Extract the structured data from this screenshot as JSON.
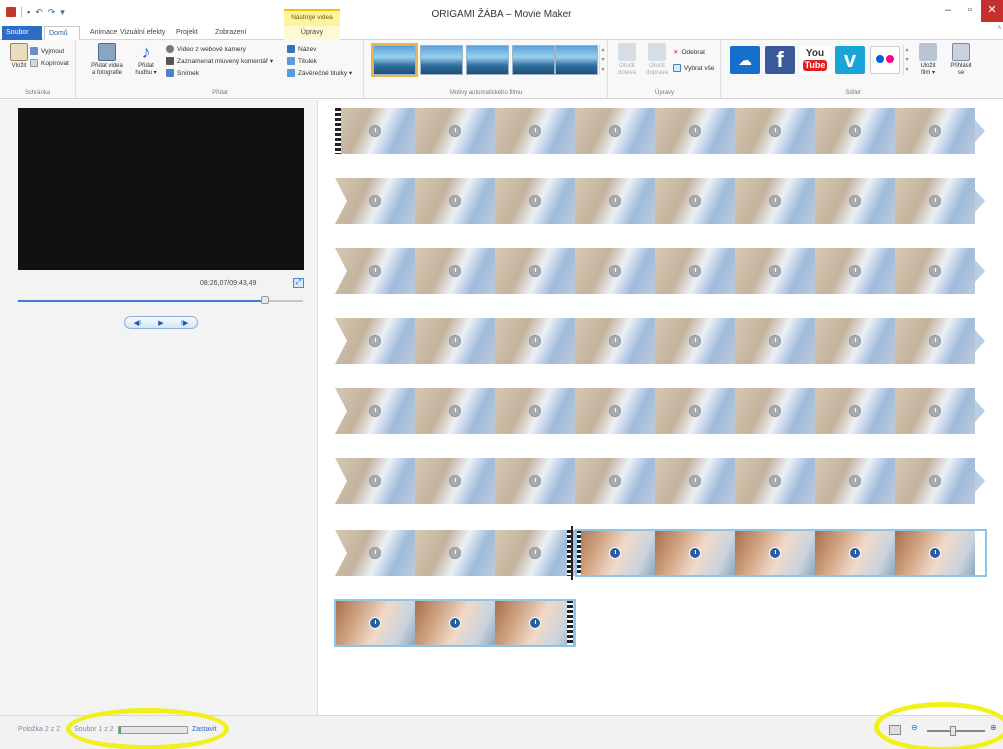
{
  "window": {
    "title": "ORIGAMI ŽÁBA – Movie Maker",
    "contextual_tab_group": "Nástroje videa",
    "minimize_glyph": "–",
    "maximize_glyph": "▫",
    "close_glyph": "✕",
    "help_glyph": "^"
  },
  "tabs": [
    "Soubor",
    "Domů",
    "Animace",
    "Vizuální efekty",
    "Projekt",
    "Zobrazení",
    "Úpravy"
  ],
  "ribbon": {
    "clipboard": {
      "label": "Schránka",
      "paste": "Vložit",
      "cut": "Vyjmout",
      "copy": "Kopírovat"
    },
    "add": {
      "label": "Přidat",
      "add_videos_line1": "Přidat videa",
      "add_videos_line2": "a fotografie",
      "add_music_line1": "Přidat",
      "add_music_line2": "hudbu ▾",
      "webcam": "Video z webové kamery",
      "narration": "Zaznamenat mluvený komentář ▾",
      "snapshot": "Snímek",
      "title": "Název",
      "caption": "Titulek",
      "credits": "Závěrečné titulky ▾"
    },
    "autothemes": {
      "label": "Motivy automatického filmu",
      "count": 5
    },
    "editing": {
      "label": "Úpravy",
      "rotate_left_line1": "Otočit",
      "rotate_left_line2": "doleva",
      "rotate_right_line1": "Otočit",
      "rotate_right_line2": "doprava",
      "remove": "Odebrat",
      "select_all": "Vybrat vše"
    },
    "share": {
      "label": "Sdílet",
      "services": [
        "onedrive",
        "facebook",
        "youtube",
        "vimeo",
        "flickr"
      ],
      "youtube_text_top": "You",
      "youtube_text_bottom": "Tube",
      "facebook_text": "f",
      "vimeo_text": "v",
      "save_movie_line1": "Uložit",
      "save_movie_line2": "film ▾",
      "signin_line1": "Přihlásit",
      "signin_line2": "se"
    }
  },
  "preview": {
    "timecode": "08:26,07/09:43,49",
    "seek_position_percent": 86.7,
    "prev_frame": "◀I",
    "play": "▶",
    "next_frame": "I▶"
  },
  "status": {
    "item": "Položka 2 z 2",
    "file": "Soubor 1 z 2",
    "stop": "Zastavit",
    "progress_percent": 3,
    "zoom_minus": "⊖",
    "zoom_plus": "⊕",
    "zoom_level_percent": 45
  },
  "colors": {
    "accent": "#2b6cc4",
    "highlight": "#f0f01a",
    "contextual_tab": "#fff3a0",
    "close_button": "#c7302c"
  }
}
